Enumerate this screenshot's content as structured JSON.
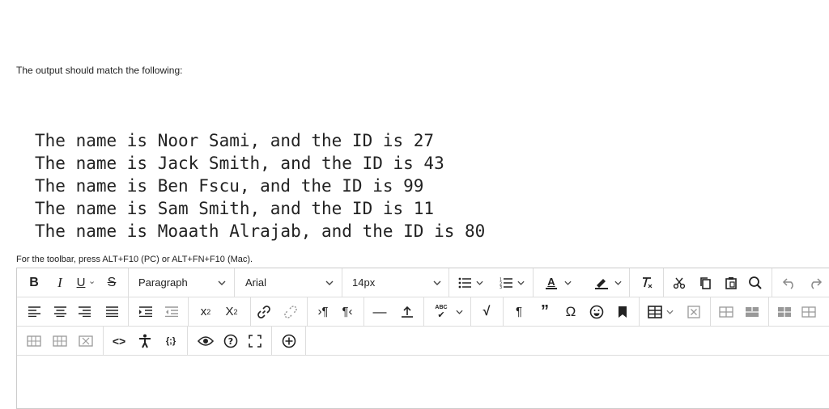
{
  "intro_text": "The output should match the following:",
  "output_lines": [
    "The name is Noor Sami, and the ID is 27",
    "The name is Jack Smith, and the ID is 43",
    "The name is Ben Fscu, and the ID is 99",
    "The name is Sam Smith, and the ID is 11",
    "The name is Moaath Alrajab, and the ID is 80"
  ],
  "toolbar_hint": "For the toolbar, press ALT+F10 (PC) or ALT+FN+F10 (Mac).",
  "toolbar": {
    "bold": "B",
    "italic": "I",
    "underline": "U",
    "strike": "S",
    "block_format": "Paragraph",
    "font_family": "Arial",
    "font_size": "14px",
    "text_color_label": "A",
    "spellcheck_label": "ABC",
    "special_char": "Ω"
  }
}
